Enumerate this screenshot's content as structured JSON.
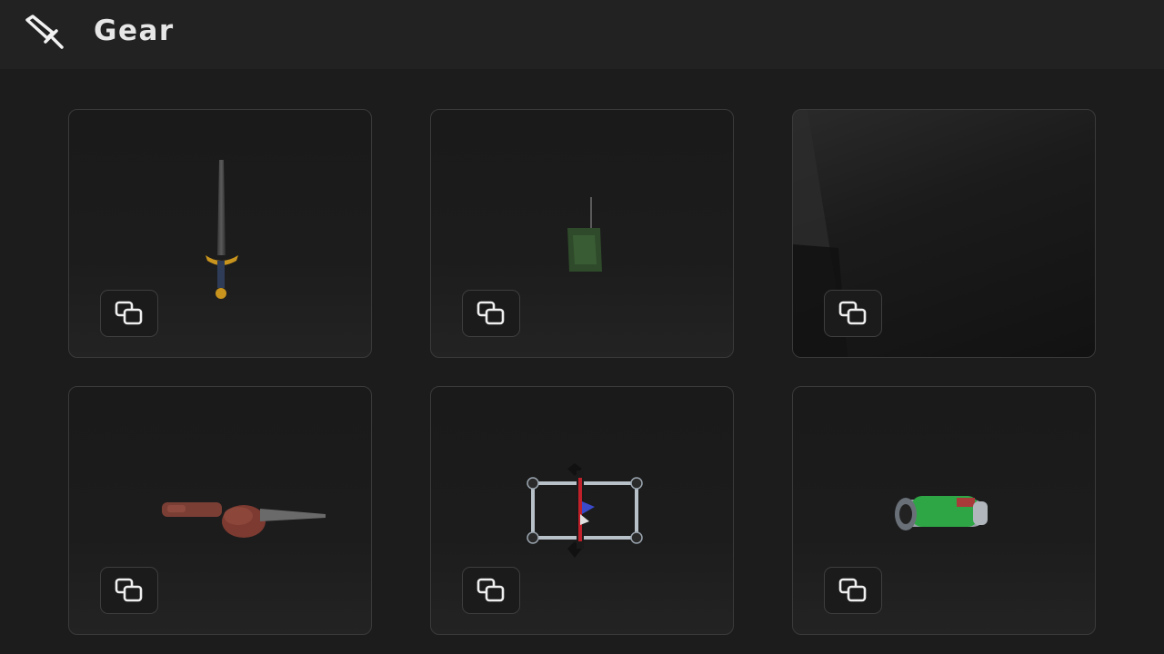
{
  "header": {
    "title": "Gear",
    "icon": "sword-icon"
  },
  "items": [
    {
      "name": "sword",
      "icon": "copy-icon"
    },
    {
      "name": "green-backpack",
      "icon": "copy-icon"
    },
    {
      "name": "dark-item",
      "icon": "copy-icon"
    },
    {
      "name": "drill-tool",
      "icon": "copy-icon"
    },
    {
      "name": "cage-staff",
      "icon": "copy-icon"
    },
    {
      "name": "green-launcher",
      "icon": "copy-icon"
    }
  ],
  "colors": {
    "background": "#1c1c1c",
    "header_bg": "#222222",
    "card_border": "#3a3a3a",
    "text": "#e6e6e6"
  }
}
